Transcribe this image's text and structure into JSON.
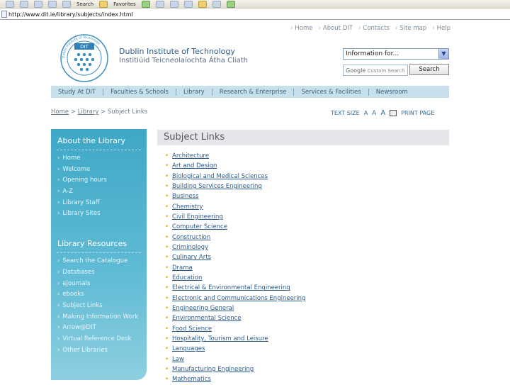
{
  "browser": {
    "toolbar_labels": [
      "Search",
      "Favorites"
    ],
    "address": "http://www.dit.ie/library/subjects/index.html"
  },
  "topnav": [
    "Home",
    "About DIT",
    "Contacts",
    "Site map",
    "Help"
  ],
  "site": {
    "logo_text": "DIT",
    "logo_ring_text": "Dublin Institute of Technology",
    "name": "Dublin Institute of Technology",
    "name_irish": "Institiúid Teicneolaíochta Átha Cliath"
  },
  "search": {
    "dropdown_value": "Information for...",
    "placeholder_brand": "Google",
    "placeholder": "Custom Search",
    "button": "Search"
  },
  "mainnav": [
    "Study At DIT",
    "Faculties & Schools",
    "Library",
    "Research & Enterprise",
    "Services & Facilities",
    "Newsroom"
  ],
  "breadcrumb": {
    "home": "Home",
    "library": "Library",
    "current": "Subject Links",
    "sep": ">"
  },
  "tools": {
    "text_size": "TEXT SIZE",
    "sizes": [
      "A",
      "A",
      "A"
    ],
    "print": "PRINT PAGE"
  },
  "sidebar": {
    "about_heading": "About the Library",
    "about_items": [
      "Home",
      "Welcome",
      "Opening hours",
      "A-Z",
      "Library Staff",
      "Library Sites"
    ],
    "resources_heading": "Library Resources",
    "resources_items": [
      "Search the Catalogue",
      "Databases",
      "ejournals",
      "ebooks",
      "Subject Links",
      "Making Information Work",
      "Arrow@DIT",
      "Virtual Reference Desk",
      "Other Libraries"
    ]
  },
  "content": {
    "heading": "Subject Links",
    "subjects": [
      "Architecture",
      "Art and Design",
      "Biological and Medical Sciences",
      "Building Services Engineering",
      "Business",
      "Chemistry",
      "Civil Engineering",
      "Computer Science",
      "Construction",
      "Criminology",
      "Culinary Arts",
      "Drama",
      "Education",
      "Electrical & Environmental Engineering",
      "Electronic and Communications Engineering",
      "Engineering General",
      "Environmental Science",
      "Food Science",
      "Hospitality, Tourism and Leisure",
      "Languages",
      "Law",
      "Manufacturing Engineering",
      "Mathematics"
    ]
  },
  "colors": {
    "sidebar": "#3ea8c6",
    "mainnav": "#c7e0ec",
    "link": "#2a5a8c",
    "bullet": "#e6a800",
    "heading_bg": "#e6e6ea"
  }
}
